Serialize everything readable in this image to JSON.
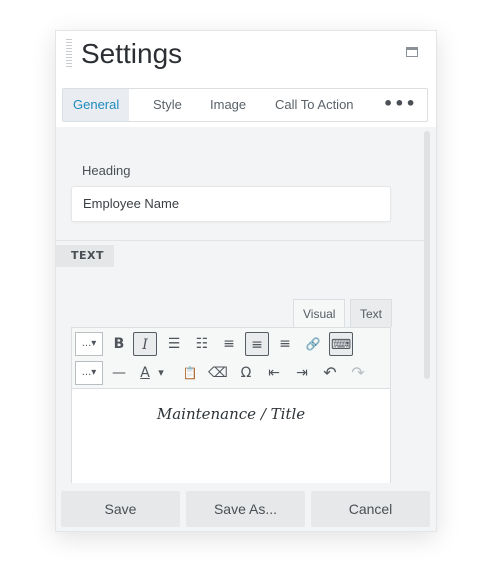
{
  "header": {
    "title": "Settings",
    "maximize_icon": "maximize-icon"
  },
  "tabs": [
    {
      "label": "General",
      "active": true
    },
    {
      "label": "Style",
      "active": false
    },
    {
      "label": "Image",
      "active": false
    },
    {
      "label": "Call To Action",
      "active": false
    }
  ],
  "tabs_more": "•••",
  "general": {
    "heading_label": "Heading",
    "heading_value": "Employee Name"
  },
  "text_section": {
    "tag": "TEXT",
    "editor_tabs": {
      "visual": "Visual",
      "text": "Text"
    },
    "toolbar_row1": [
      {
        "name": "format-dropdown",
        "glyph": "...▾"
      },
      {
        "name": "bold-icon",
        "glyph": "B"
      },
      {
        "name": "italic-icon",
        "glyph": "I"
      },
      {
        "name": "bullet-list-icon",
        "glyph": "☰"
      },
      {
        "name": "numbered-list-icon",
        "glyph": "☷"
      },
      {
        "name": "align-left-icon",
        "glyph": "≡"
      },
      {
        "name": "align-center-icon",
        "glyph": "≡"
      },
      {
        "name": "align-right-icon",
        "glyph": "≡"
      },
      {
        "name": "link-icon",
        "glyph": "🔗"
      },
      {
        "name": "toolbar-toggle-icon",
        "glyph": "⌨"
      }
    ],
    "toolbar_row2": [
      {
        "name": "font-dropdown",
        "glyph": "...▾"
      },
      {
        "name": "horizontal-line-icon",
        "glyph": "—"
      },
      {
        "name": "text-color-icon",
        "glyph": "A"
      },
      {
        "name": "text-color-dropdown-icon",
        "glyph": "▾"
      },
      {
        "name": "paste-text-icon",
        "glyph": "📋"
      },
      {
        "name": "clear-formatting-icon",
        "glyph": "⌫"
      },
      {
        "name": "special-character-icon",
        "glyph": "Ω"
      },
      {
        "name": "outdent-icon",
        "glyph": "⇤"
      },
      {
        "name": "indent-icon",
        "glyph": "⇥"
      },
      {
        "name": "undo-icon",
        "glyph": "↶"
      },
      {
        "name": "redo-icon",
        "glyph": "↷"
      }
    ],
    "editor_content": "Maintenance / Title"
  },
  "footer": {
    "save": "Save",
    "save_as": "Save As...",
    "cancel": "Cancel"
  },
  "colors": {
    "active_tab_text": "#1e8cbe",
    "panel_bg": "#f3f4f5"
  }
}
